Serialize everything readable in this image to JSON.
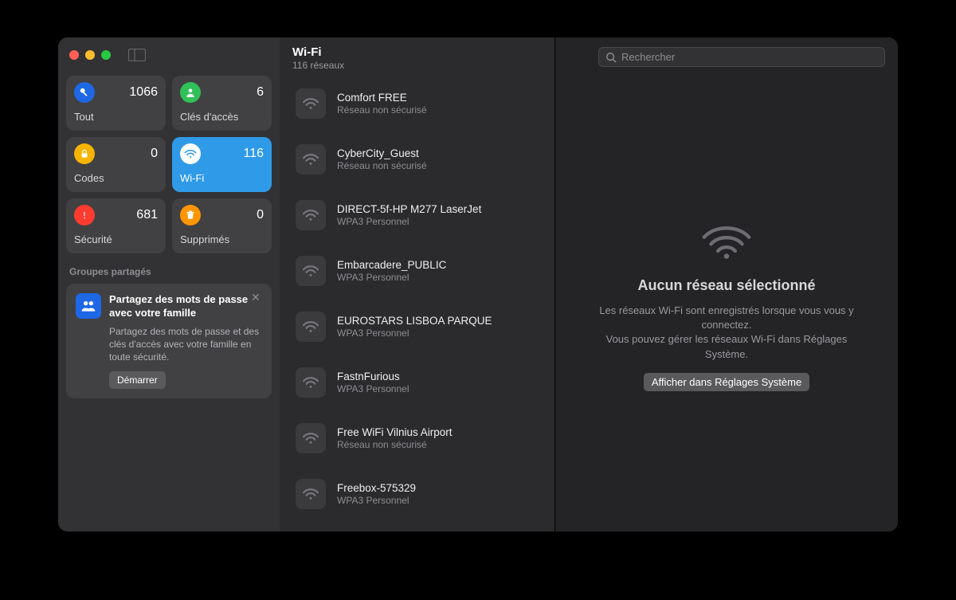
{
  "sidebar": {
    "categories": [
      {
        "id": "all",
        "label": "Tout",
        "count": 1066,
        "icon_bg": "#1e68e6",
        "icon": "key"
      },
      {
        "id": "passkeys",
        "label": "Clés d'accès",
        "count": 6,
        "icon_bg": "#30c158",
        "icon": "person"
      },
      {
        "id": "codes",
        "label": "Codes",
        "count": 0,
        "icon_bg": "#f5b400",
        "icon": "lock"
      },
      {
        "id": "wifi",
        "label": "Wi-Fi",
        "count": 116,
        "icon_bg": "#ffffff",
        "icon": "wifi",
        "selected": true
      },
      {
        "id": "security",
        "label": "Sécurité",
        "count": 681,
        "icon_bg": "#ff3b30",
        "icon": "alert"
      },
      {
        "id": "deleted",
        "label": "Supprimés",
        "count": 0,
        "icon_bg": "#ff9500",
        "icon": "trash"
      }
    ],
    "shared_header": "Groupes partagés",
    "promo": {
      "title": "Partagez des mots de passe avec votre famille",
      "body": "Partagez des mots de passe et des clés d'accès avec votre famille en toute sécurité.",
      "button": "Démarrer"
    }
  },
  "middle": {
    "title": "Wi-Fi",
    "subtitle": "116 réseaux",
    "networks": [
      {
        "name": "Comfort FREE",
        "security": "Réseau non sécurisé"
      },
      {
        "name": "CyberCity_Guest",
        "security": "Réseau non sécurisé"
      },
      {
        "name": "DIRECT-5f-HP M277 LaserJet",
        "security": "WPA3 Personnel"
      },
      {
        "name": "Embarcadere_PUBLIC",
        "security": "WPA3 Personnel"
      },
      {
        "name": "EUROSTARS LISBOA PARQUE",
        "security": "WPA3 Personnel"
      },
      {
        "name": "FastnFurious",
        "security": "WPA3 Personnel"
      },
      {
        "name": "Free WiFi Vilnius Airport",
        "security": "Réseau non sécurisé"
      },
      {
        "name": "Freebox-575329",
        "security": "WPA3 Personnel"
      }
    ]
  },
  "detail": {
    "search_placeholder": "Rechercher",
    "empty_title": "Aucun réseau sélectionné",
    "empty_line1": "Les réseaux Wi-Fi sont enregistrés lorsque vous vous y connectez.",
    "empty_line2": "Vous pouvez gérer les réseaux Wi-Fi dans Réglages Système.",
    "button": "Afficher dans Réglages Système"
  }
}
